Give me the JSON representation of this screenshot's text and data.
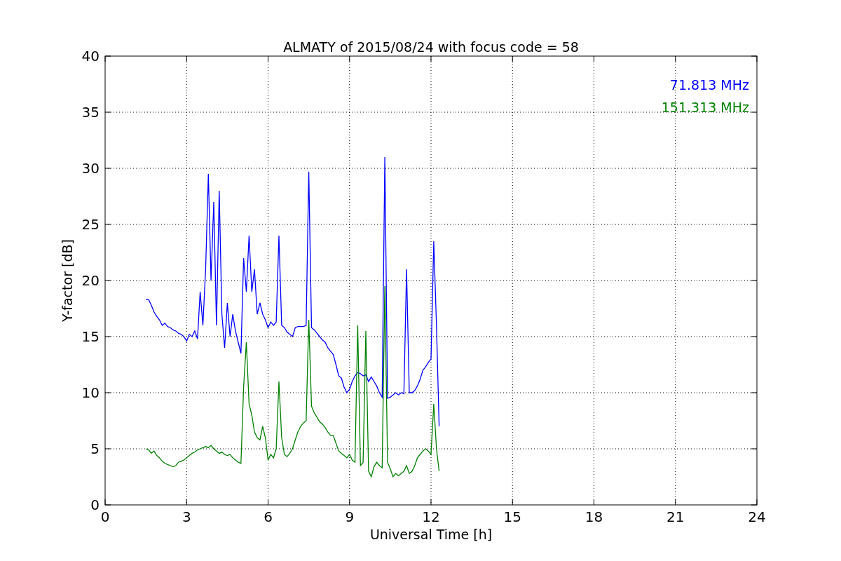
{
  "chart": {
    "chart_data": {
      "type": "line",
      "title": "ALMATY of 2015/08/24 with focus code = 58",
      "xlabel": "Universal Time [h]",
      "ylabel": "Y-factor [dB]",
      "grid": true,
      "xlim": [
        0,
        24
      ],
      "ylim": [
        0,
        40
      ],
      "xticks": [
        0,
        3,
        6,
        9,
        12,
        15,
        18,
        21,
        24
      ],
      "yticks": [
        0,
        5,
        10,
        15,
        20,
        25,
        30,
        35,
        40
      ],
      "x": [
        1.5,
        1.6,
        1.7,
        1.8,
        1.9,
        2.0,
        2.1,
        2.2,
        2.3,
        2.4,
        2.5,
        2.6,
        2.7,
        2.8,
        2.9,
        3.0,
        3.1,
        3.2,
        3.3,
        3.4,
        3.5,
        3.6,
        3.7,
        3.8,
        3.9,
        4.0,
        4.1,
        4.2,
        4.3,
        4.4,
        4.5,
        4.6,
        4.7,
        4.8,
        4.9,
        5.0,
        5.1,
        5.2,
        5.3,
        5.4,
        5.5,
        5.6,
        5.7,
        5.8,
        5.9,
        6.0,
        6.1,
        6.2,
        6.3,
        6.4,
        6.5,
        6.6,
        6.7,
        6.8,
        6.9,
        7.0,
        7.1,
        7.2,
        7.3,
        7.4,
        7.5,
        7.6,
        7.7,
        7.8,
        7.9,
        8.0,
        8.1,
        8.2,
        8.3,
        8.4,
        8.5,
        8.6,
        8.7,
        8.8,
        8.9,
        9.0,
        9.1,
        9.2,
        9.3,
        9.4,
        9.5,
        9.6,
        9.7,
        9.8,
        9.9,
        10.0,
        10.1,
        10.2,
        10.3,
        10.4,
        10.5,
        10.6,
        10.7,
        10.8,
        10.9,
        11.0,
        11.1,
        11.2,
        11.3,
        11.4,
        11.5,
        11.6,
        11.7,
        11.8,
        11.9,
        12.0,
        12.1,
        12.2,
        12.3
      ],
      "series": [
        {
          "name": "71.813 MHz",
          "color": "#0000ff",
          "values": [
            18.3,
            18.3,
            17.8,
            17.2,
            16.8,
            16.5,
            16.0,
            16.2,
            15.9,
            15.8,
            15.6,
            15.5,
            15.3,
            15.2,
            15.0,
            14.6,
            15.2,
            15.0,
            15.5,
            14.8,
            19,
            16,
            21,
            29.5,
            20,
            27,
            16,
            28,
            17,
            14,
            18,
            15,
            17,
            15.5,
            14.5,
            13.5,
            22,
            19,
            24,
            19,
            21,
            17,
            18,
            17,
            16.5,
            15.8,
            16.3,
            16.0,
            16.3,
            24,
            16.0,
            15.8,
            15.4,
            15.2,
            15.0,
            15.8,
            15.9,
            15.9,
            15.9,
            16.0,
            29.7,
            15.8,
            15.6,
            15.3,
            15.0,
            14.7,
            14.5,
            14.0,
            13.7,
            13.4,
            12.5,
            11.5,
            11.3,
            10.5,
            10,
            10.3,
            11,
            11.5,
            11.8,
            11.7,
            11.5,
            11.6,
            11.0,
            11.4,
            11.0,
            10.6,
            10,
            9.6,
            31,
            9.5,
            9.6,
            9.8,
            10,
            9.8,
            10,
            9.9,
            21,
            10,
            10,
            10.2,
            10.6,
            11.2,
            12,
            12.3,
            12.7,
            13,
            23.5,
            16,
            7
          ]
        },
        {
          "name": "151.313 MHz",
          "color": "#008000",
          "values": [
            5,
            4.9,
            4.6,
            4.8,
            4.4,
            4.2,
            3.9,
            3.7,
            3.6,
            3.5,
            3.4,
            3.5,
            3.8,
            3.9,
            4.0,
            4.2,
            4.4,
            4.6,
            4.7,
            4.9,
            5.0,
            5.1,
            5.2,
            5.1,
            5.3,
            5.0,
            4.8,
            4.6,
            4.7,
            4.5,
            4.4,
            4.5,
            4.2,
            4.0,
            3.8,
            3.7,
            10.5,
            14.5,
            9,
            8,
            6.5,
            6,
            5.8,
            7,
            6,
            4,
            4.5,
            4.2,
            5,
            11,
            6,
            4.5,
            4.3,
            4.6,
            5,
            5.8,
            6.5,
            7,
            7.3,
            7.5,
            16.5,
            8.8,
            8.2,
            7.8,
            7.4,
            7.2,
            6.9,
            6.5,
            6.2,
            6.2,
            5.5,
            4.8,
            4.6,
            4.4,
            4.2,
            4.5,
            4.0,
            3.8,
            16,
            3.5,
            3.8,
            15.5,
            3,
            2.5,
            3.4,
            3.8,
            3.5,
            3.3,
            19.5,
            3.8,
            3.2,
            2.5,
            2.8,
            2.6,
            2.8,
            3.0,
            3.5,
            2.8,
            3.0,
            3.5,
            4.2,
            4.5,
            4.8,
            5.0,
            4.8,
            4.5,
            9,
            5,
            3
          ]
        }
      ]
    }
  }
}
